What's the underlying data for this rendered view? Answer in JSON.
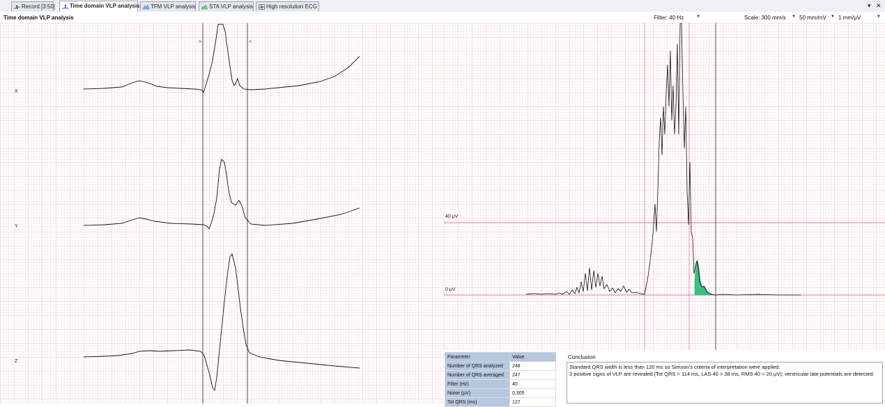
{
  "tabs": [
    {
      "label": "Record [3:50]",
      "icon": "ecg-record-icon"
    },
    {
      "label": "Time domain VLP analysis",
      "icon": "vlp-wave-icon"
    },
    {
      "label": "TFM VLP analysis",
      "icon": "tfm-surface-icon"
    },
    {
      "label": "STA VLP analysis",
      "icon": "sta-surface-icon"
    },
    {
      "label": "High resolution ECG",
      "icon": "ecg-grid-icon"
    }
  ],
  "window_controls": {
    "menu": "▾",
    "close": "✕"
  },
  "header": {
    "title": "Time domain VLP analysis",
    "filter": "Filter: 40 Hz",
    "scale_label": "Scale: 300 mm/s",
    "amp_scale": "50 mm/mV",
    "vm_scale": "1 mm/μV"
  },
  "leads": {
    "x": "X",
    "y": "Y",
    "z": "Z"
  },
  "vector_plot": {
    "level_40": "40 μV",
    "level_0": "0 μV"
  },
  "table": {
    "headers": [
      "Parameter",
      "Value"
    ],
    "rows": [
      {
        "name": "Number of QRS analyzed",
        "value": "248"
      },
      {
        "name": "Number of QRS averaged",
        "value": "247"
      },
      {
        "name": "Filter (Hz)",
        "value": "40"
      },
      {
        "name": "Noise (μV)",
        "value": "0,305"
      },
      {
        "name": "Tot QRS (ms)",
        "value": "127"
      }
    ]
  },
  "conclusion": {
    "label": "Conclusion",
    "line1": "Standard QRS width is less than 120 ms so Simson's criteria of interpretation were applied.",
    "line2": "3 positive signs of  VLP are revealed (Tot QRS > 114 ms, LAS 40 > 38 ms, RMS 40 < 20 μV); ventricular late  potentials are detected."
  },
  "colors": {
    "grid_minor": "#f3c8cf",
    "grid_major": "#e79aa8",
    "trace": "#111111",
    "las_fill": "#3cc07f",
    "table_header": "#b7c7dd"
  }
}
